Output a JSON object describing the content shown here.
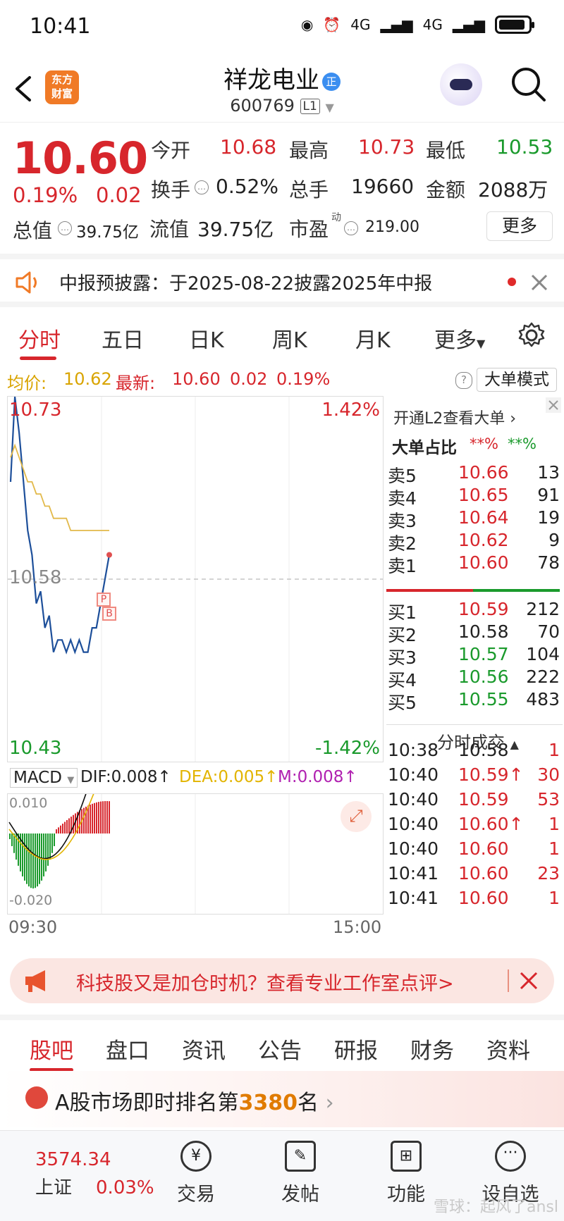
{
  "status_bar": {
    "time": "10:41",
    "net1": "4G",
    "net2": "4G"
  },
  "header": {
    "logo": "东方\n财富",
    "logo_line1": "东方",
    "logo_line2": "财富",
    "stock_name": "祥龙电业",
    "badge": "正",
    "stock_code": "600769",
    "level": "L1"
  },
  "quote": {
    "price": "10.60",
    "change_pct": "0.19%",
    "change_amt": "0.02",
    "open_label": "今开",
    "open": "10.68",
    "high_label": "最高",
    "high": "10.73",
    "low_label": "最低",
    "low": "10.53",
    "turnover_label": "换手",
    "turnover": "0.52%",
    "volume_label": "总手",
    "volume": "19660",
    "amount_label": "金额",
    "amount": "2088万",
    "mktcap_label": "总值",
    "mktcap": "39.75亿",
    "float_label": "流值",
    "float": "39.75亿",
    "pe_label": "市盈",
    "pe_sup": "动",
    "pe": "219.00",
    "more": "更多"
  },
  "notice": {
    "text": "中报预披露：于2025-08-22披露2025年中报"
  },
  "tabs": [
    "分时",
    "五日",
    "日K",
    "周K",
    "月K",
    "更多"
  ],
  "avg": {
    "avg_label": "均价:",
    "avg": "10.62",
    "latest_label": "最新:",
    "latest": "10.60",
    "chg": "0.02",
    "pct": "0.19%",
    "mode": "大单模式"
  },
  "chart": {
    "y_top": "10.73",
    "y_mid": "10.58",
    "y_bottom": "10.43",
    "pct_top": "1.42%",
    "pct_bottom": "-1.42%",
    "time_start": "09:30",
    "time_end": "15:00",
    "marker_p": "P",
    "marker_b": "B"
  },
  "chart_data": {
    "type": "line",
    "series": [
      {
        "values": [
          10.66,
          10.73,
          10.7,
          10.66,
          10.62,
          10.6,
          10.56,
          10.57,
          10.54,
          10.55,
          10.52,
          10.53,
          10.53,
          10.52,
          10.53,
          10.52,
          10.53,
          10.52,
          10.52,
          10.54,
          10.54,
          10.56,
          10.58,
          10.6
        ]
      },
      {
        "values": [
          10.68,
          10.69,
          10.68,
          10.67,
          10.66,
          10.66,
          10.65,
          10.65,
          10.64,
          10.64,
          10.63,
          10.63,
          10.63,
          10.63,
          10.62,
          10.62,
          10.62,
          10.62,
          10.62,
          10.62,
          10.62,
          10.62,
          10.62,
          10.62
        ]
      }
    ],
    "ylim": [
      10.43,
      10.73
    ]
  },
  "macd": {
    "label": "MACD",
    "dif": "DIF:0.008↑",
    "dea": "DEA:0.005↑",
    "m": "M:0.008↑",
    "top": "0.010",
    "bottom": "-0.020"
  },
  "book": {
    "l2_link": "开通L2查看大单",
    "ratio_label": "大单占比",
    "ratio_red": "**%",
    "ratio_green": "**%",
    "asks": [
      {
        "label": "卖5",
        "price": "10.66",
        "vol": "13",
        "color": "red"
      },
      {
        "label": "卖4",
        "price": "10.65",
        "vol": "91",
        "color": "red"
      },
      {
        "label": "卖3",
        "price": "10.64",
        "vol": "19",
        "color": "red"
      },
      {
        "label": "卖2",
        "price": "10.62",
        "vol": "9",
        "color": "red"
      },
      {
        "label": "卖1",
        "price": "10.60",
        "vol": "78",
        "color": "red"
      }
    ],
    "bids": [
      {
        "label": "买1",
        "price": "10.59",
        "vol": "212",
        "color": "red"
      },
      {
        "label": "买2",
        "price": "10.58",
        "vol": "70",
        "color": "black"
      },
      {
        "label": "买3",
        "price": "10.57",
        "vol": "104",
        "color": "green"
      },
      {
        "label": "买4",
        "price": "10.56",
        "vol": "222",
        "color": "green"
      },
      {
        "label": "买5",
        "price": "10.55",
        "vol": "483",
        "color": "green"
      }
    ],
    "ticks_label": "分时成交",
    "ticks": [
      {
        "time": "10:38",
        "price": "10.58",
        "vol": "1",
        "pcolor": "black",
        "vcolor": "red"
      },
      {
        "time": "10:40",
        "price": "10.59↑",
        "vol": "30",
        "pcolor": "red",
        "vcolor": "red"
      },
      {
        "time": "10:40",
        "price": "10.59",
        "vol": "53",
        "pcolor": "red",
        "vcolor": "red"
      },
      {
        "time": "10:40",
        "price": "10.60↑",
        "vol": "1",
        "pcolor": "red",
        "vcolor": "red"
      },
      {
        "time": "10:40",
        "price": "10.60",
        "vol": "1",
        "pcolor": "red",
        "vcolor": "red"
      },
      {
        "time": "10:41",
        "price": "10.60",
        "vol": "23",
        "pcolor": "red",
        "vcolor": "red"
      },
      {
        "time": "10:41",
        "price": "10.60",
        "vol": "1",
        "pcolor": "red",
        "vcolor": "red"
      }
    ]
  },
  "ad": {
    "text": "科技股又是加仓时机？查看专业工作室点评>"
  },
  "bottom_tabs": [
    "股吧",
    "盘口",
    "资讯",
    "公告",
    "研报",
    "财务",
    "资料"
  ],
  "rank": {
    "prefix": "A股市场即时排名第",
    "num": "3380",
    "suffix": "名"
  },
  "nav": {
    "index_value": "3574.34",
    "index_name": "上证",
    "index_pct": "0.03%",
    "items": [
      "交易",
      "发帖",
      "功能",
      "设自选"
    ]
  },
  "watermark": "雪球：起风了ansl",
  "colors": {
    "red": "#d7262c",
    "green": "#1a9a2c",
    "accent": "#f07a26"
  }
}
